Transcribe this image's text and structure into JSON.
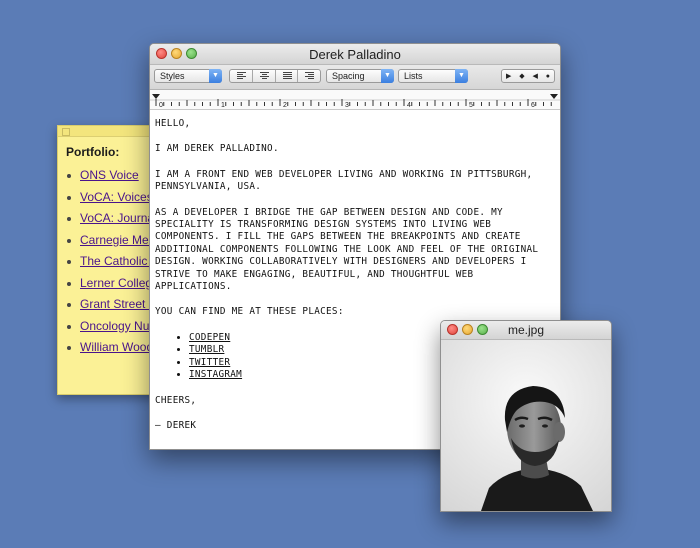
{
  "sticky": {
    "title": "Portfolio:",
    "items": [
      {
        "label": "ONS Voice"
      },
      {
        "label": "VoCA: Voices of Central Appalachia"
      },
      {
        "label": "VoCA: Journal"
      },
      {
        "label": "Carnegie Mellon"
      },
      {
        "label": "The Catholic University"
      },
      {
        "label": "Lerner College"
      },
      {
        "label": "Grant Street Group"
      },
      {
        "label": "Oncology Nursing"
      },
      {
        "label": "William Woods"
      }
    ]
  },
  "editor": {
    "title": "Derek Palladino",
    "toolbar": {
      "styles": "Styles",
      "spacing": "Spacing",
      "lists": "Lists"
    },
    "ruler_labels": [
      "0",
      "1",
      "2",
      "3",
      "4",
      "5",
      "6"
    ],
    "doc": {
      "greeting": "HELLO,",
      "intro": "I AM DEREK PALLADINO.",
      "para1": "I AM A FRONT END WEB DEVELOPER LIVING AND WORKING IN PITTSBURGH, PENNSYLVANIA, USA.",
      "para2": "AS A DEVELOPER I BRIDGE THE GAP BETWEEN DESIGN AND CODE. MY SPECIALITY IS TRANSFORMING DESIGN SYSTEMS INTO LIVING WEB COMPONENTS. I FILL THE GAPS BETWEEN THE BREAKPOINTS AND CREATE ADDITIONAL COMPONENTS FOLLOWING THE LOOK AND FEEL OF THE ORIGINAL DESIGN. WORKING COLLABORATIVELY WITH DESIGNERS AND DEVELOPERS I STRIVE TO MAKE ENGAGING, BEAUTIFUL, AND THOUGHTFUL WEB APPLICATIONS.",
      "find_me": "YOU CAN FIND ME AT THESE PLACES:",
      "links": [
        "CODEPEN",
        "TUMBLR",
        "TWITTER",
        "INSTAGRAM"
      ],
      "closing": "CHEERS,",
      "signature": "— DEREK"
    }
  },
  "image_window": {
    "title": "me.jpg"
  },
  "colors": {
    "desktop": "#5b7cb6",
    "sticky": "#fbf196",
    "link_purple": "#4a148c",
    "popup_accent": "#3b7fe0"
  }
}
